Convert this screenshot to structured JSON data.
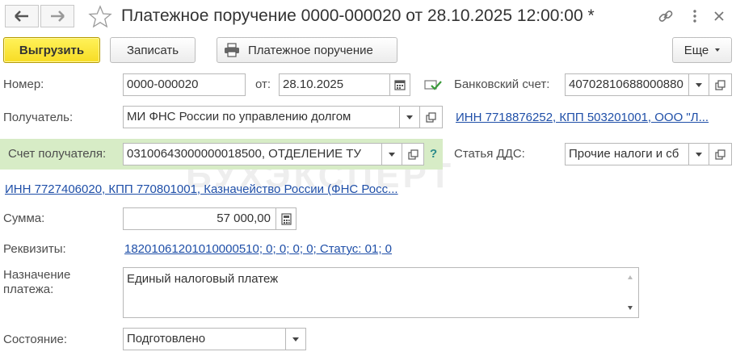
{
  "window": {
    "title": "Платежное поручение 0000-000020 от 28.10.2025 12:00:00 *",
    "icons": [
      "arrow-left-icon",
      "arrow-right-icon",
      "star-icon",
      "link-icon",
      "more-vertical-icon",
      "close-icon"
    ]
  },
  "toolbar": {
    "upload_label": "Выгрузить",
    "save_label": "Записать",
    "print_label": "Платежное поручение",
    "more_label": "Еще"
  },
  "form": {
    "number": {
      "label": "Номер:",
      "value": "0000-000020"
    },
    "date": {
      "label": "от:",
      "value": "28.10.2025"
    },
    "bank_account": {
      "label": "Банковский счет:",
      "value": "40702810688000880"
    },
    "recipient": {
      "label": "Получатель:",
      "value": "МИ ФНС России по управлению долгом"
    },
    "recipient_info_link": "ИНН 7718876252, КПП 503201001, ООО \"Л...",
    "recipient_account": {
      "label": "Счет получателя:",
      "value": "03100643000000018500, ОТДЕЛЕНИЕ ТУ",
      "help": "?"
    },
    "dds_item": {
      "label": "Статья ДДС:",
      "value": "Прочие налоги и сб"
    },
    "treasury_link": "ИНН 7727406020, КПП 770801001, Казначейство России (ФНС Росс...",
    "amount": {
      "label": "Сумма:",
      "value": "57 000,00"
    },
    "requisites": {
      "label": "Реквизиты:",
      "value": "18201061201010000510; 0; 0; 0; 0; Статус: 01; 0"
    },
    "purpose": {
      "label_line1": "Назначение",
      "label_line2": "платежа:",
      "value": "Единый налоговый платеж"
    },
    "state": {
      "label": "Состояние:",
      "value": "Подготовлено"
    }
  },
  "watermark": "БУХЭКСПЕРТ"
}
